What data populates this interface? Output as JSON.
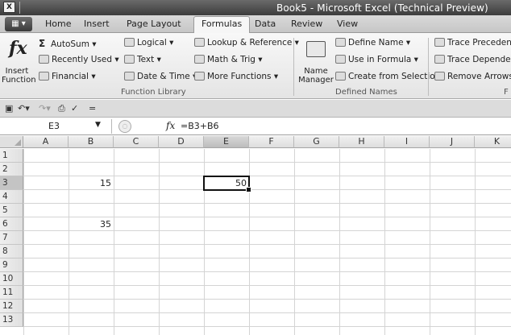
{
  "window": {
    "title": "Book5 - Microsoft Excel (Technical Preview)",
    "app_icon": "excel-icon"
  },
  "tabs": [
    {
      "label": "Home"
    },
    {
      "label": "Insert"
    },
    {
      "label": "Page Layout"
    },
    {
      "label": "Formulas",
      "active": true
    },
    {
      "label": "Data"
    },
    {
      "label": "Review"
    },
    {
      "label": "View"
    }
  ],
  "ribbon": {
    "function_library": {
      "insert_function": "Insert\nFunction",
      "autosum": "AutoSum ▾",
      "recently_used": "Recently Used ▾",
      "financial": "Financial ▾",
      "logical": "Logical ▾",
      "text": "Text ▾",
      "date_time": "Date & Time ▾",
      "lookup": "Lookup & Reference ▾",
      "math": "Math & Trig ▾",
      "more": "More Functions ▾",
      "label": "Function Library"
    },
    "defined_names": {
      "name_manager": "Name\nManager",
      "define_name": "Define Name ▾",
      "use_in_formula": "Use in Formula ▾",
      "create_from_selection": "Create from Selection",
      "label": "Defined Names"
    },
    "formula_auditing": {
      "trace_precedents": "Trace Precedents",
      "trace_dependents": "Trace Dependent",
      "remove_arrows": "Remove Arrows ▾",
      "label": "F"
    }
  },
  "formula_bar": {
    "name_box": "E3",
    "formula": "=B3+B6"
  },
  "grid": {
    "columns": [
      "A",
      "B",
      "C",
      "D",
      "E",
      "F",
      "G",
      "H",
      "I",
      "J",
      "K"
    ],
    "rows": [
      "1",
      "2",
      "3",
      "4",
      "5",
      "6",
      "7",
      "8",
      "9",
      "10",
      "11",
      "12",
      "13"
    ],
    "selected_column": "E",
    "selected_row": "3",
    "cells": [
      {
        "ref": "B3",
        "value": "15"
      },
      {
        "ref": "B6",
        "value": "35"
      },
      {
        "ref": "E3",
        "value": "50"
      }
    ]
  }
}
